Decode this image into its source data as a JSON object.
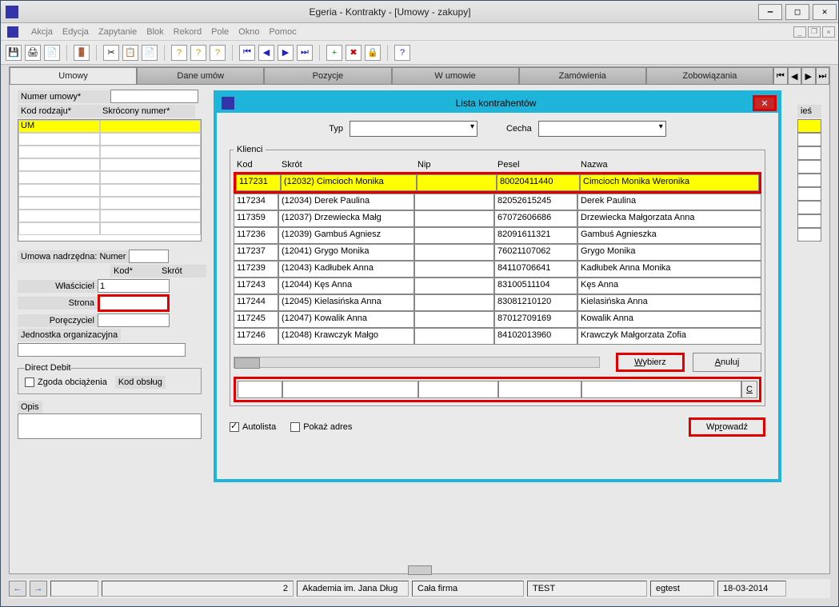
{
  "window": {
    "title": "Egeria - Kontrakty - [Umowy - zakupy]"
  },
  "menu": [
    "Akcja",
    "Edycja",
    "Zapytanie",
    "Blok",
    "Rekord",
    "Pole",
    "Okno",
    "Pomoc"
  ],
  "tabs": [
    "Umowy",
    "Dane umów",
    "Pozycje",
    "W umowie",
    "Zamówienia",
    "Zobowiązania"
  ],
  "form": {
    "numer_umowy_lbl": "Numer umowy*",
    "kod_rodzaju_lbl": "Kod rodzaju*",
    "skrocony_numer_lbl": "Skrócony numer*",
    "kod_rodzaju_val": "UM",
    "umowa_nadrzedna_lbl": "Umowa nadrzędna: Numer",
    "kod_lbl": "Kod*",
    "skrot_lbl": "Skrót",
    "wlasciciel_lbl": "Właściciel",
    "wlasciciel_val": "1",
    "strona_lbl": "Strona",
    "poreczyciel_lbl": "Poręczyciel",
    "jednostka_lbl": "Jednostka organizacyjna",
    "direct_debit_lbl": "Direct Debit",
    "zgoda_lbl": "Zgoda obciążenia",
    "kod_obslug_lbl": "Kod obsług",
    "opis_lbl": "Opis",
    "ries_lbl": "ieś"
  },
  "popup": {
    "title": "Lista kontrahentów",
    "typ_lbl": "Typ",
    "cecha_lbl": "Cecha",
    "klienci_lbl": "Klienci",
    "hdr": {
      "kod": "Kod",
      "skrot": "Skrót",
      "nip": "Nip",
      "pesel": "Pesel",
      "nazwa": "Nazwa"
    },
    "rows": [
      {
        "kod": "117231",
        "skrot": "(12032) Cimcioch Monika",
        "nip": "",
        "pesel": "80020411440",
        "nazwa": "Cimcioch Monika Weronika",
        "sel": true
      },
      {
        "kod": "117234",
        "skrot": "(12034) Derek Paulina",
        "nip": "",
        "pesel": "82052615245",
        "nazwa": "Derek Paulina"
      },
      {
        "kod": "117359",
        "skrot": "(12037) Drzewiecka Małg",
        "nip": "",
        "pesel": "67072606686",
        "nazwa": "Drzewiecka Małgorzata Anna"
      },
      {
        "kod": "117236",
        "skrot": "(12039) Gambuś Agniesz",
        "nip": "",
        "pesel": "82091611321",
        "nazwa": "Gambuś Agnieszka"
      },
      {
        "kod": "117237",
        "skrot": "(12041) Grygo Monika",
        "nip": "",
        "pesel": "76021107062",
        "nazwa": "Grygo Monika"
      },
      {
        "kod": "117239",
        "skrot": "(12043) Kadłubek Anna",
        "nip": "",
        "pesel": "84110706641",
        "nazwa": "Kadłubek Anna Monika"
      },
      {
        "kod": "117243",
        "skrot": "(12044) Kęs Anna",
        "nip": "",
        "pesel": "83100511104",
        "nazwa": "Kęs Anna"
      },
      {
        "kod": "117244",
        "skrot": "(12045) Kielasińska Anna",
        "nip": "",
        "pesel": "83081210120",
        "nazwa": "Kielasińska Anna"
      },
      {
        "kod": "117245",
        "skrot": "(12047) Kowalik Anna",
        "nip": "",
        "pesel": "87012709169",
        "nazwa": "Kowalik Anna"
      },
      {
        "kod": "117246",
        "skrot": "(12048) Krawczyk Małgo",
        "nip": "",
        "pesel": "84102013960",
        "nazwa": "Krawczyk Małgorzata Zofia"
      }
    ],
    "wybierz": "Wybierz",
    "anuluj": "Anuluj",
    "c_btn": "C",
    "autolista": "Autolista",
    "pokaz_adres": "Pokaż adres",
    "wprowadz": "Wprowadź"
  },
  "status": {
    "num": "2",
    "org": "Akademia im. Jana Dług",
    "firma": "Cała firma",
    "env": "TEST",
    "user": "egtest",
    "date": "18-03-2014"
  }
}
